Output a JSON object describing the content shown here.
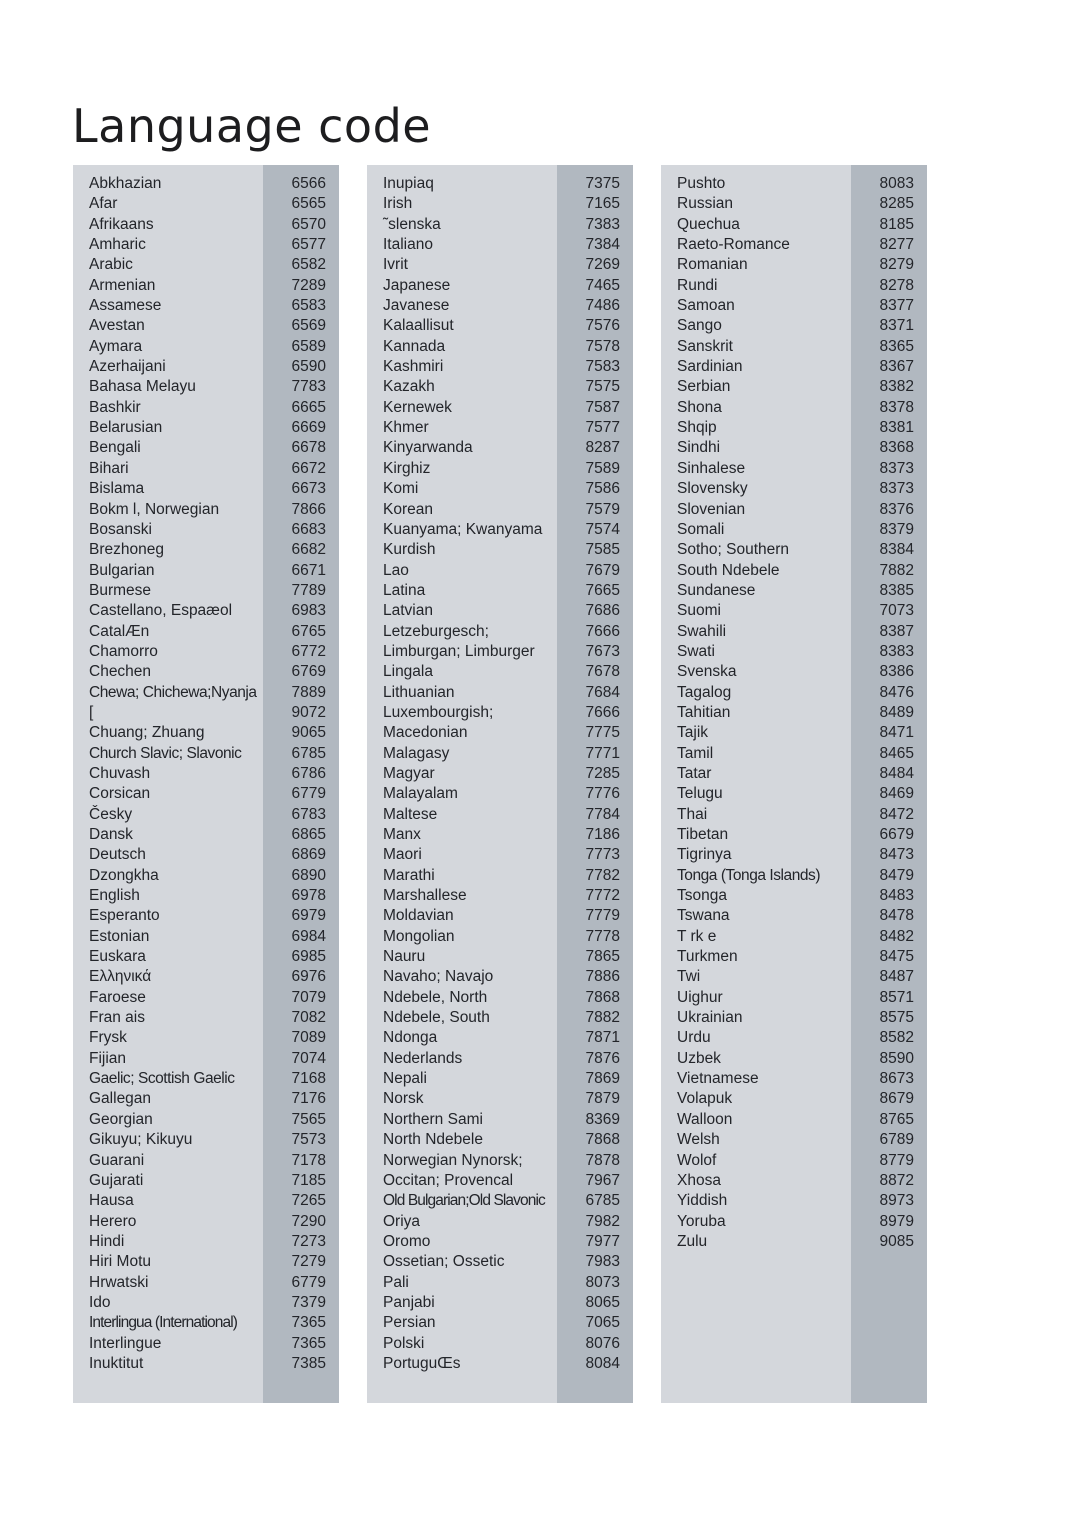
{
  "title": "Language code",
  "columns": [
    {
      "id": "column-1",
      "entries": [
        {
          "name": "Abkhazian",
          "code": "6566"
        },
        {
          "name": "Afar",
          "code": "6565"
        },
        {
          "name": "Afrikaans",
          "code": "6570"
        },
        {
          "name": "Amharic",
          "code": "6577"
        },
        {
          "name": "Arabic",
          "code": "6582"
        },
        {
          "name": "Armenian",
          "code": "7289"
        },
        {
          "name": "Assamese",
          "code": "6583"
        },
        {
          "name": "Avestan",
          "code": "6569"
        },
        {
          "name": "Aymara",
          "code": "6589"
        },
        {
          "name": "Azerhaijani",
          "code": "6590"
        },
        {
          "name": "Bahasa Melayu",
          "code": "7783"
        },
        {
          "name": "Bashkir",
          "code": "6665"
        },
        {
          "name": "Belarusian",
          "code": "6669"
        },
        {
          "name": "Bengali",
          "code": "6678"
        },
        {
          "name": "Bihari",
          "code": "6672"
        },
        {
          "name": "Bislama",
          "code": "6673"
        },
        {
          "name": "Bokm l, Norwegian",
          "code": "7866"
        },
        {
          "name": "Bosanski",
          "code": "6683"
        },
        {
          "name": "Brezhoneg",
          "code": "6682"
        },
        {
          "name": "Bulgarian",
          "code": "6671"
        },
        {
          "name": "Burmese",
          "code": "7789"
        },
        {
          "name": "Castellano, Espaæol",
          "code": "6983"
        },
        {
          "name": "CatalÆn",
          "code": "6765"
        },
        {
          "name": "Chamorro",
          "code": "6772"
        },
        {
          "name": "Chechen",
          "code": "6769"
        },
        {
          "name": "Chewa; Chichewa;Nyanja",
          "code": "7889"
        },
        {
          "name": "[",
          "code": "9072"
        },
        {
          "name": "Chuang; Zhuang",
          "code": "9065"
        },
        {
          "name": "Church Slavic; Slavonic",
          "code": "6785"
        },
        {
          "name": "Chuvash",
          "code": "6786"
        },
        {
          "name": "Corsican",
          "code": "6779"
        },
        {
          "name": "Česky",
          "code": "6783"
        },
        {
          "name": "Dansk",
          "code": "6865"
        },
        {
          "name": "Deutsch",
          "code": "6869"
        },
        {
          "name": "Dzongkha",
          "code": "6890"
        },
        {
          "name": "English",
          "code": "6978"
        },
        {
          "name": "Esperanto",
          "code": "6979"
        },
        {
          "name": "Estonian",
          "code": "6984"
        },
        {
          "name": "Euskara",
          "code": "6985"
        },
        {
          "name": "Ελληνικά",
          "code": "6976"
        },
        {
          "name": "Faroese",
          "code": "7079"
        },
        {
          "name": "Fran ais",
          "code": "7082"
        },
        {
          "name": "Frysk",
          "code": "7089"
        },
        {
          "name": "Fijian",
          "code": "7074"
        },
        {
          "name": "Gaelic; Scottish Gaelic",
          "code": "7168"
        },
        {
          "name": "Gallegan",
          "code": "7176"
        },
        {
          "name": "Georgian",
          "code": "7565"
        },
        {
          "name": "Gikuyu; Kikuyu",
          "code": "7573"
        },
        {
          "name": "Guarani",
          "code": "7178"
        },
        {
          "name": "Gujarati",
          "code": "7185"
        },
        {
          "name": "Hausa",
          "code": "7265"
        },
        {
          "name": "Herero",
          "code": "7290"
        },
        {
          "name": "Hindi",
          "code": "7273"
        },
        {
          "name": "Hiri Motu",
          "code": "7279"
        },
        {
          "name": "Hrwatski",
          "code": "6779"
        },
        {
          "name": "Ido",
          "code": "7379"
        },
        {
          "name": "Interlingua (International)",
          "code": "7365"
        },
        {
          "name": "Interlingue",
          "code": "7365"
        },
        {
          "name": "Inuktitut",
          "code": "7385"
        }
      ]
    },
    {
      "id": "column-2",
      "entries": [
        {
          "name": "Inupiaq",
          "code": "7375"
        },
        {
          "name": "Irish",
          "code": "7165"
        },
        {
          "name": "˜slenska",
          "code": "7383"
        },
        {
          "name": "Italiano",
          "code": "7384"
        },
        {
          "name": "Ivrit",
          "code": "7269"
        },
        {
          "name": "Japanese",
          "code": "7465"
        },
        {
          "name": "Javanese",
          "code": "7486"
        },
        {
          "name": "Kalaallisut",
          "code": "7576"
        },
        {
          "name": "Kannada",
          "code": "7578"
        },
        {
          "name": "Kashmiri",
          "code": "7583"
        },
        {
          "name": "Kazakh",
          "code": "7575"
        },
        {
          "name": "Kernewek",
          "code": "7587"
        },
        {
          "name": "Khmer",
          "code": "7577"
        },
        {
          "name": "Kinyarwanda",
          "code": "8287"
        },
        {
          "name": "Kirghiz",
          "code": "7589"
        },
        {
          "name": "Komi",
          "code": "7586"
        },
        {
          "name": "Korean",
          "code": "7579"
        },
        {
          "name": "Kuanyama; Kwanyama",
          "code": "7574"
        },
        {
          "name": "Kurdish",
          "code": "7585"
        },
        {
          "name": "Lao",
          "code": "7679"
        },
        {
          "name": "Latina",
          "code": "7665"
        },
        {
          "name": "Latvian",
          "code": "7686"
        },
        {
          "name": "Letzeburgesch;",
          "code": "7666"
        },
        {
          "name": "Limburgan; Limburger",
          "code": "7673"
        },
        {
          "name": "Lingala",
          "code": "7678"
        },
        {
          "name": "Lithuanian",
          "code": "7684"
        },
        {
          "name": "Luxembourgish;",
          "code": "7666"
        },
        {
          "name": "Macedonian",
          "code": "7775"
        },
        {
          "name": "Malagasy",
          "code": "7771"
        },
        {
          "name": "Magyar",
          "code": "7285"
        },
        {
          "name": "Malayalam",
          "code": "7776"
        },
        {
          "name": "Maltese",
          "code": "7784"
        },
        {
          "name": "Manx",
          "code": "7186"
        },
        {
          "name": "Maori",
          "code": "7773"
        },
        {
          "name": "Marathi",
          "code": "7782"
        },
        {
          "name": "Marshallese",
          "code": "7772"
        },
        {
          "name": "Moldavian",
          "code": "7779"
        },
        {
          "name": "Mongolian",
          "code": "7778"
        },
        {
          "name": "Nauru",
          "code": "7865"
        },
        {
          "name": "Navaho; Navajo",
          "code": "7886"
        },
        {
          "name": "Ndebele, North",
          "code": "7868"
        },
        {
          "name": "Ndebele, South",
          "code": "7882"
        },
        {
          "name": "Ndonga",
          "code": "7871"
        },
        {
          "name": "Nederlands",
          "code": "7876"
        },
        {
          "name": "Nepali",
          "code": "7869"
        },
        {
          "name": "Norsk",
          "code": "7879"
        },
        {
          "name": "Northern Sami",
          "code": "8369"
        },
        {
          "name": "North Ndebele",
          "code": "7868"
        },
        {
          "name": "Norwegian Nynorsk;",
          "code": "7878"
        },
        {
          "name": "Occitan; Provencal",
          "code": "7967"
        },
        {
          "name": "Old Bulgarian;Old Slavonic",
          "code": "6785"
        },
        {
          "name": "Oriya",
          "code": "7982"
        },
        {
          "name": "Oromo",
          "code": "7977"
        },
        {
          "name": "Ossetian; Ossetic",
          "code": "7983"
        },
        {
          "name": "Pali",
          "code": "8073"
        },
        {
          "name": "Panjabi",
          "code": "8065"
        },
        {
          "name": "Persian",
          "code": "7065"
        },
        {
          "name": "Polski",
          "code": "8076"
        },
        {
          "name": "PortuguŒs",
          "code": "8084"
        }
      ]
    },
    {
      "id": "column-3",
      "entries": [
        {
          "name": "Pushto",
          "code": "8083"
        },
        {
          "name": "Russian",
          "code": "8285"
        },
        {
          "name": "Quechua",
          "code": "8185"
        },
        {
          "name": "Raeto-Romance",
          "code": "8277"
        },
        {
          "name": "Romanian",
          "code": "8279"
        },
        {
          "name": "Rundi",
          "code": "8278"
        },
        {
          "name": "Samoan",
          "code": "8377"
        },
        {
          "name": "Sango",
          "code": "8371"
        },
        {
          "name": "Sanskrit",
          "code": "8365"
        },
        {
          "name": "Sardinian",
          "code": "8367"
        },
        {
          "name": "Serbian",
          "code": "8382"
        },
        {
          "name": "Shona",
          "code": "8378"
        },
        {
          "name": "Shqip",
          "code": "8381"
        },
        {
          "name": "Sindhi",
          "code": "8368"
        },
        {
          "name": "Sinhalese",
          "code": "8373"
        },
        {
          "name": "Slovensky",
          "code": "8373"
        },
        {
          "name": "Slovenian",
          "code": "8376"
        },
        {
          "name": "Somali",
          "code": "8379"
        },
        {
          "name": "Sotho; Southern",
          "code": "8384"
        },
        {
          "name": "South Ndebele",
          "code": "7882"
        },
        {
          "name": "Sundanese",
          "code": "8385"
        },
        {
          "name": "Suomi",
          "code": "7073"
        },
        {
          "name": "Swahili",
          "code": "8387"
        },
        {
          "name": "Swati",
          "code": "8383"
        },
        {
          "name": "Svenska",
          "code": "8386"
        },
        {
          "name": "Tagalog",
          "code": "8476"
        },
        {
          "name": "Tahitian",
          "code": "8489"
        },
        {
          "name": "Tajik",
          "code": "8471"
        },
        {
          "name": "Tamil",
          "code": "8465"
        },
        {
          "name": "Tatar",
          "code": "8484"
        },
        {
          "name": "Telugu",
          "code": "8469"
        },
        {
          "name": "Thai",
          "code": "8472"
        },
        {
          "name": "Tibetan",
          "code": "6679"
        },
        {
          "name": "Tigrinya",
          "code": "8473"
        },
        {
          "name": "Tonga (Tonga Islands)",
          "code": "8479"
        },
        {
          "name": "Tsonga",
          "code": "8483"
        },
        {
          "name": "Tswana",
          "code": "8478"
        },
        {
          "name": "T rk e",
          "code": "8482"
        },
        {
          "name": "Turkmen",
          "code": "8475"
        },
        {
          "name": "Twi",
          "code": "8487"
        },
        {
          "name": "Uighur",
          "code": "8571"
        },
        {
          "name": "Ukrainian",
          "code": "8575"
        },
        {
          "name": "Urdu",
          "code": "8582"
        },
        {
          "name": "Uzbek",
          "code": "8590"
        },
        {
          "name": "Vietnamese",
          "code": "8673"
        },
        {
          "name": "Volapuk",
          "code": "8679"
        },
        {
          "name": "Walloon",
          "code": "8765"
        },
        {
          "name": "Welsh",
          "code": "6789"
        },
        {
          "name": "Wolof",
          "code": "8779"
        },
        {
          "name": "Xhosa",
          "code": "8872"
        },
        {
          "name": "Yiddish",
          "code": "8973"
        },
        {
          "name": "Yoruba",
          "code": "8979"
        },
        {
          "name": "Zulu",
          "code": "9085"
        }
      ]
    }
  ],
  "colors": {
    "panel_light": "#d4d7dc",
    "panel_dark": "#b1b8c0",
    "text": "#23252a",
    "title": "#1d1d1f",
    "page_background": "#ffffff"
  }
}
